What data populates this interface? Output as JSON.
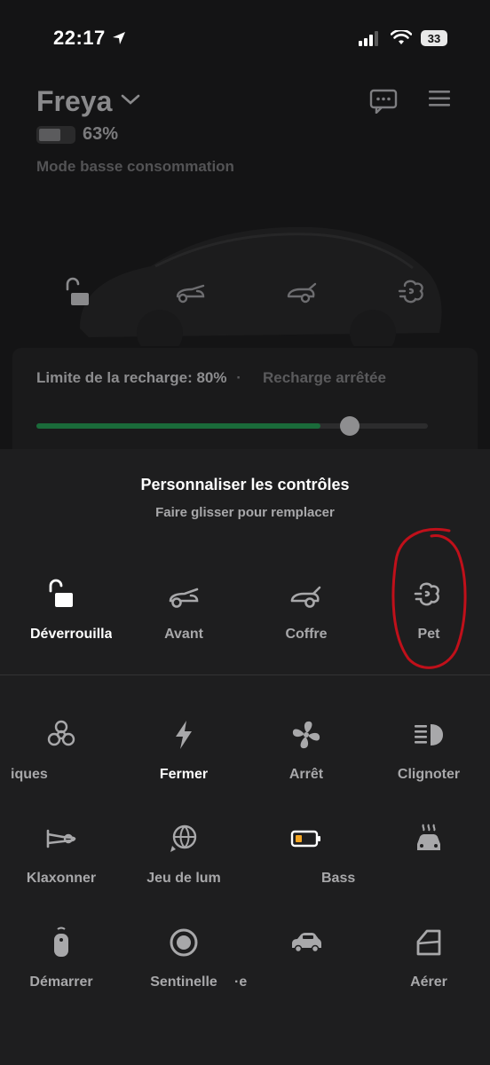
{
  "status_bar": {
    "time": "22:17",
    "battery": "33"
  },
  "header": {
    "car_name": "Freya",
    "battery_percent": "63%",
    "battery_fraction": 0.63,
    "mode": "Mode basse consommation"
  },
  "charge": {
    "limit_label": "Limite de la recharge: 80%",
    "separator": "·",
    "status": "Recharge arrêtée",
    "level": 0.63,
    "limit": 0.8
  },
  "sheet": {
    "title": "Personnaliser les contrôles",
    "subtitle": "Faire glisser pour remplacer"
  },
  "selected_controls": [
    {
      "label": "Déverrouilla",
      "icon": "unlock-icon",
      "active": true
    },
    {
      "label": "Avant",
      "icon": "frunk-icon",
      "active": false
    },
    {
      "label": "Coffre",
      "icon": "trunk-icon",
      "active": false
    },
    {
      "label": "Pet",
      "icon": "fart-icon",
      "active": false
    }
  ],
  "available_controls": [
    {
      "label": "iques",
      "icon": "biohazard-icon",
      "active": false
    },
    {
      "label": "Fermer",
      "icon": "lightning-icon",
      "active": true
    },
    {
      "label": "Arrêt",
      "icon": "fan-icon",
      "active": false
    },
    {
      "label": "Clignoter",
      "icon": "headlight-icon",
      "active": false
    },
    {
      "label": "Klaxonner",
      "icon": "horn-icon",
      "active": false
    },
    {
      "label": "Jeu de lum",
      "icon": "lightshow-icon",
      "active": false
    },
    {
      "label": "Bass",
      "icon": "battery-icon",
      "active": false
    },
    {
      "label": "",
      "icon": "seat-heater-car-icon",
      "active": false
    },
    {
      "label": "Démarrer",
      "icon": "key-fob-icon",
      "active": false
    },
    {
      "label": "Sentinelle",
      "icon": "sentry-icon",
      "active": false
    },
    {
      "label": "·e",
      "icon": "car-side-icon",
      "active": false
    },
    {
      "label": "Aérer",
      "icon": "vent-window-icon",
      "active": false
    }
  ],
  "colors": {
    "accent_green": "#1a6b3a",
    "annotation_red": "#c0101a",
    "battery_chip": "#f5a623"
  }
}
